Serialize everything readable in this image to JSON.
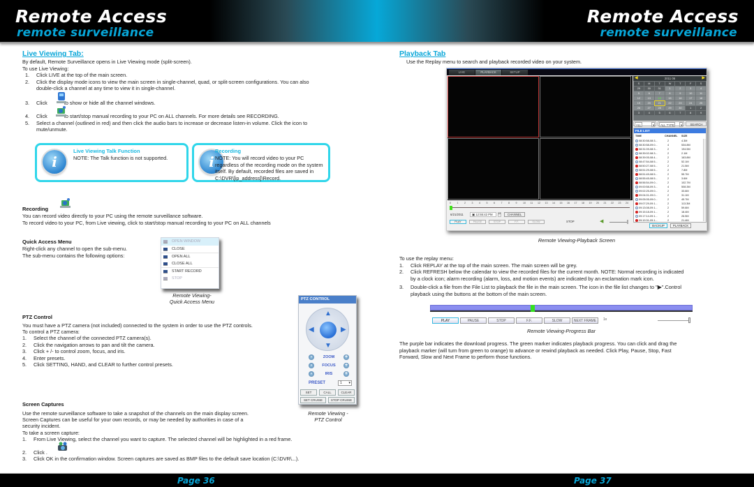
{
  "header": {
    "left": {
      "title": "Remote Access",
      "subtitle": "remote surveillance"
    },
    "right": {
      "title": "Remote Access",
      "subtitle": "remote surveillance"
    }
  },
  "footer": {
    "left_page": "Page  36",
    "right_page": "Page  37"
  },
  "left": {
    "live_viewing": {
      "heading": "Live Viewing Tab:",
      "intro": "By default, Remote Surveillance opens in Live Viewing mode (split-screen).",
      "lead": "To use Live Viewing:",
      "steps": [
        {
          "n": "1.",
          "text": "Click LIVE at the top of the main screen."
        },
        {
          "n": "2.",
          "text": "Click the display mode icons to view the main screen in single-channel, quad, or split-screen configurations. You can also",
          "cont": "double-click a channel at any time to view it in single-channel."
        },
        {
          "n": "3.",
          "pre": "Click",
          "text": "to show or hide all the channel windows.",
          "icon": "channel-windows-icon"
        },
        {
          "n": "4.",
          "pre": "Click",
          "text": "to start/stop manual recording to your PC on ALL channels. For more details see RECORDING.",
          "icon": "record-icon"
        },
        {
          "n": "5.",
          "text": "Select a channel (outlined in red) and then click the audio bars to increase or decrease listen-in volume. Click the icon to",
          "cont": "mute/unmute."
        }
      ]
    },
    "notes": [
      {
        "title": "Live Viewing Talk Function",
        "body": "NOTE: The Talk function is not supported.",
        "icon": "info-icon"
      },
      {
        "title": "Recording",
        "body": "NOTE: You will record video to your PC regardless of the recording mode on the system itself. By default, recorded files are saved in C:\\DVR\\[ip_address]\\Record.",
        "icon": "info-icon"
      }
    ],
    "recording": {
      "heading": "Recording",
      "icon": "record-icon",
      "lines": [
        "You can record video directly to your PC using the remote surveillance software.",
        "To record video to your PC, from Live viewing, click to start/stop manual recording to your PC on ALL channels"
      ]
    },
    "quick_access": {
      "heading": "Quick Access Menu",
      "lines": [
        "Right-click any channel to open the sub-menu.",
        "The sub-menu contains the following options:"
      ],
      "menu": [
        {
          "label": "OPEN WINDOW",
          "state": "disabled-highlighted"
        },
        {
          "label": "CLOSE",
          "state": "enabled"
        },
        {
          "label": "OPEN ALL",
          "state": "enabled"
        },
        {
          "label": "CLOSE ALL",
          "state": "enabled"
        },
        {
          "label": "START RECORD",
          "state": "enabled"
        },
        {
          "label": "STOP",
          "state": "disabled"
        }
      ],
      "caption_line1": "Remote Viewing-",
      "caption_line2": "Quick Access Menu"
    },
    "ptz": {
      "heading": "PTZ Control",
      "intro": "You must have a PTZ camera (not included) connected to the system in order to use the PTZ controls.",
      "lead": "To control a PTZ camera:",
      "steps": [
        {
          "n": "1.",
          "text": "Select the channel of the connected PTZ camera(s)."
        },
        {
          "n": "2.",
          "text": "Click the navigation arrows to pan and tilt the camera."
        },
        {
          "n": "3.",
          "text": "Click + /- to control zoom, focus, and iris."
        },
        {
          "n": "4.",
          "text": "Enter presets."
        },
        {
          "n": "5.",
          "text": "Click SETTING, HAND, and CLEAR to further control presets."
        }
      ],
      "panel": {
        "title": "PTZ CONTROL",
        "rows": [
          "ZOOM",
          "FOCUS",
          "IRIS"
        ],
        "preset_label": "PRESET",
        "preset_value": "1",
        "buttons_row1": [
          "SET",
          "CALL",
          "CLEAR"
        ],
        "buttons_row2": [
          "SET CRUISE",
          "STOP CRUISE"
        ]
      },
      "caption_line1": "Remote Viewing -",
      "caption_line2": "PTZ Control"
    },
    "screen_captures": {
      "heading": "Screen Captures",
      "lines": [
        "Use the remote surveillance software to take a snapshot of the channels on the main display screen.",
        "Screen Captures can be useful for your own records, or may be needed by authorities in case of a",
        "security incident."
      ],
      "lead": "To take a screen capture:",
      "steps": [
        {
          "n": "1.",
          "text": "From Live Viewing, select the channel you want to capture. The selected channel will be highlighted in a red frame."
        },
        {
          "n": "2.",
          "text": "Click .",
          "icon": "camera-capture-icon"
        },
        {
          "n": "3.",
          "text": "Click OK in the confirmation window. Screen captures are saved as BMP files to the default save location (C:\\DVR\\...)."
        }
      ]
    }
  },
  "right": {
    "playback": {
      "heading": "Playback Tab",
      "intro": "Use the Replay menu to search and playback recorded video on your system.",
      "screen": {
        "tabs": [
          {
            "label": "LIVE",
            "active": false
          },
          {
            "label": "PLAYBACK",
            "active": true
          },
          {
            "label": "SETUP",
            "active": false
          }
        ],
        "calendar": {
          "title": "2011  06",
          "weekdays": [
            "S",
            "M",
            "T",
            "W",
            "T",
            "F",
            "S"
          ],
          "days": [
            "29",
            "30",
            "31",
            "1",
            "2",
            "3",
            "4",
            "5",
            "6",
            "7",
            "8",
            "9",
            "10",
            "11",
            "12",
            "13",
            "14",
            "15",
            "16",
            "17",
            "18",
            "19",
            "20",
            "21",
            "22",
            "23",
            "24",
            "25",
            "26",
            "27",
            "28",
            "29",
            "30",
            "1",
            "2",
            "3",
            "4",
            "5",
            "6",
            "7",
            "8",
            "9"
          ],
          "today": "14",
          "selected": "21"
        },
        "filters": {
          "channel": "ALL",
          "type": "ALL TYPE",
          "search_label": "SEARCH"
        },
        "file_list": {
          "title": "FILE LIST",
          "columns": [
            "TIME",
            "CHANNEL",
            "SIZE"
          ],
          "rows": [
            {
              "type": "clock",
              "time": "08:30:58-08:3...",
              "channel": "2",
              "size": "4.3M"
            },
            {
              "type": "clock",
              "time": "08:30:58-09:0...",
              "channel": "4",
              "size": "534.8M"
            },
            {
              "type": "alarm",
              "time": "08:31:09-08:3...",
              "channel": "2",
              "size": "194.5M"
            },
            {
              "type": "clock",
              "time": "08:39:02-08:3...",
              "channel": "2",
              "size": "2.1M"
            },
            {
              "type": "alarm",
              "time": "08:39:05-08:4...",
              "channel": "2",
              "size": "163.8M"
            },
            {
              "type": "clock",
              "time": "08:47:54-08:5...",
              "channel": "2",
              "size": "52.1M"
            },
            {
              "type": "alarm",
              "time": "08:50:27-08:5...",
              "channel": "2",
              "size": "21.5M"
            },
            {
              "type": "clock",
              "time": "08:51:29-08:5...",
              "channel": "2",
              "size": "7.8M"
            },
            {
              "type": "alarm",
              "time": "08:51:49-08:5...",
              "channel": "2",
              "size": "55.7M"
            },
            {
              "type": "clock",
              "time": "08:55:45-08:5...",
              "channel": "2",
              "size": "3.6M"
            },
            {
              "type": "alarm",
              "time": "08:56:54-09:0...",
              "channel": "2",
              "size": "102.7M"
            },
            {
              "type": "clock",
              "time": "09:00:58-09:3...",
              "channel": "4",
              "size": "508.3M"
            },
            {
              "type": "clock",
              "time": "09:02:25-09:0...",
              "channel": "2",
              "size": "33.6M"
            },
            {
              "type": "alarm",
              "time": "09:04:01-09:0...",
              "channel": "2",
              "size": "31.1M"
            },
            {
              "type": "clock",
              "time": "09:05:05-09:0...",
              "channel": "2",
              "size": "45.7M"
            },
            {
              "type": "alarm",
              "time": "09:07:29-09:1...",
              "channel": "2",
              "size": "113.3M"
            },
            {
              "type": "clock",
              "time": "09:13:08-09:1...",
              "channel": "2",
              "size": "59.6M"
            },
            {
              "type": "alarm",
              "time": "09:15:18-09:1...",
              "channel": "2",
              "size": "18.4M"
            },
            {
              "type": "clock",
              "time": "09:17:14-09:1...",
              "channel": "2",
              "size": "26.5M"
            },
            {
              "type": "alarm",
              "time": "09:19:31-09:1...",
              "channel": "2",
              "size": "21.4M"
            }
          ],
          "buttons": [
            "BACKUP",
            "PLAYBACK"
          ]
        },
        "timeline_ticks": [
          "0",
          "1",
          "2",
          "3",
          "4",
          "5",
          "6",
          "7",
          "8",
          "9",
          "10",
          "11",
          "12",
          "13",
          "14",
          "15",
          "16",
          "17",
          "18",
          "19",
          "20",
          "21",
          "22",
          "23",
          "24"
        ],
        "date": "6/21/2011",
        "time": "12:55:42 PM",
        "channel_button": "CHANNEL",
        "controls": [
          "PLAY",
          "PAUSE",
          "STOP",
          "F.F.",
          "SLOW"
        ],
        "status": "STOP"
      },
      "caption": "Remote Viewing-Playback Screen"
    },
    "replay": {
      "lead": "To use the replay menu:",
      "steps": [
        {
          "n": "1.",
          "text": "Click REPLAY at the top of the main screen. The main screen will be grey."
        },
        {
          "n": "2.",
          "text": "Click REFRESH below the calendar to view the recorded files for the current month. NOTE: Normal recording is indicated",
          "cont": "by a clock icon; alarm recording (alarm, loss, and motion events) are indicated by an exclamation mark icon."
        },
        {
          "n": "3.",
          "text": "Double-click a file from the File List to playback the file in the main screen. The icon in the file list changes to \"",
          "text_after": "\".Control",
          "cont": "playback using the buttons at the bottom of the main screen."
        }
      ]
    },
    "progress": {
      "download_progress": 1.0,
      "playback_position": 0.39,
      "buttons": [
        "PLAY",
        "PAUSE",
        "STOP",
        "F.F.",
        "SLOW",
        "NEXT FRAME"
      ],
      "speed": "1x",
      "caption": "Remote Viewing-Progress Bar"
    },
    "explanation": [
      "The purple bar indicates the download progress. The green marker indicates playback progress. You can click and drag the",
      "playback marker (will turn from green to orange) to advance or rewind playback as needed. Click Play, Pause, Stop, Fast",
      "Forward, Slow and Next Frame to perform those functions."
    ]
  },
  "colors": {
    "accent": "#07a6d8",
    "note_border": "#2fd6ea",
    "progress_bar": "#8b8ef0",
    "playback_marker": "#35e11e",
    "selected_channel": "#c23a3a"
  }
}
